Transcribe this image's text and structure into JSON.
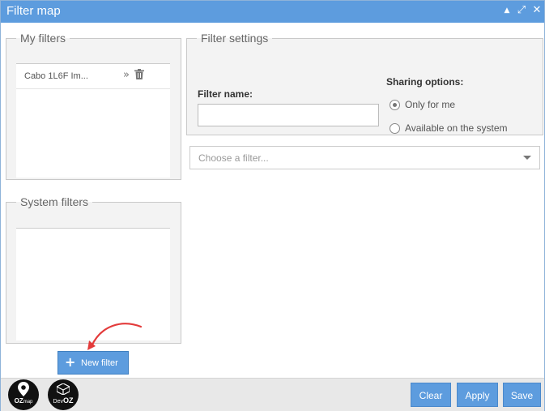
{
  "window": {
    "title": "Filter map"
  },
  "my_filters": {
    "legend": "My filters",
    "items": [
      {
        "label": "Cabo 1L6F Im..."
      }
    ]
  },
  "system_filters": {
    "legend": "System filters",
    "items": []
  },
  "settings": {
    "legend": "Filter settings",
    "name_label": "Filter name:",
    "name_value": "",
    "sharing_title": "Sharing options:",
    "options": [
      {
        "label": "Only for me",
        "selected": true
      },
      {
        "label": "Available on the system",
        "selected": false
      }
    ]
  },
  "filter_select": {
    "placeholder": "Choose a filter..."
  },
  "new_filter_label": "New filter",
  "footer": {
    "clear": "Clear",
    "apply": "Apply",
    "save": "Save",
    "logo1": {
      "line1": "OZ",
      "line2": "map"
    },
    "logo2": {
      "line1": "Dev",
      "line2": "OZ"
    }
  },
  "colors": {
    "accent": "#5d9cde",
    "arrow": "#e33b3b"
  }
}
